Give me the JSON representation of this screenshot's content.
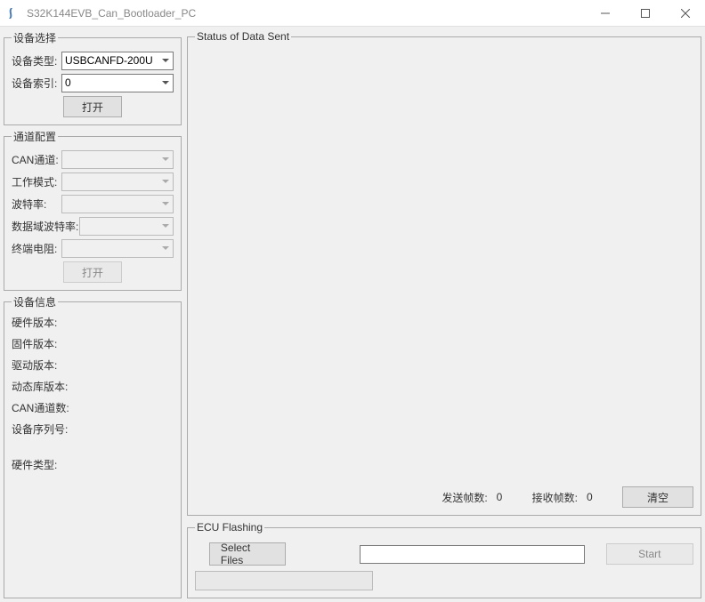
{
  "window": {
    "title": "S32K144EVB_Can_Bootloader_PC"
  },
  "deviceSelect": {
    "legend": "设备选择",
    "typeLabel": "设备类型:",
    "typeValue": "USBCANFD-200U",
    "indexLabel": "设备索引:",
    "indexValue": "0",
    "openBtn": "打开"
  },
  "channelConfig": {
    "legend": "通道配置",
    "canChannelLabel": "CAN通道:",
    "canChannelValue": "",
    "workModeLabel": "工作模式:",
    "workModeValue": "",
    "baudLabel": "波特率:",
    "baudValue": "",
    "dataBaudLabel": "数据域波特率:",
    "dataBaudValue": "",
    "termResLabel": "终端电阻:",
    "termResValue": "",
    "openBtn": "打开"
  },
  "deviceInfo": {
    "legend": "设备信息",
    "hwVerLabel": "硬件版本:",
    "hwVerValue": "",
    "fwVerLabel": "固件版本:",
    "fwVerValue": "",
    "drvVerLabel": "驱动版本:",
    "drvVerValue": "",
    "libVerLabel": "动态库版本:",
    "libVerValue": "",
    "canChCountLabel": "CAN通道数:",
    "canChCountValue": "",
    "serialLabel": "设备序列号:",
    "serialValue": "",
    "hwTypeLabel": "硬件类型:",
    "hwTypeValue": ""
  },
  "status": {
    "legend": "Status of Data Sent",
    "sentLabel": "发送帧数:",
    "sentValue": "0",
    "recvLabel": "接收帧数:",
    "recvValue": "0",
    "clearBtn": "清空"
  },
  "ecu": {
    "legend": "ECU Flashing",
    "selectBtn": "Select Files",
    "pathValue": "",
    "startBtn": "Start"
  }
}
